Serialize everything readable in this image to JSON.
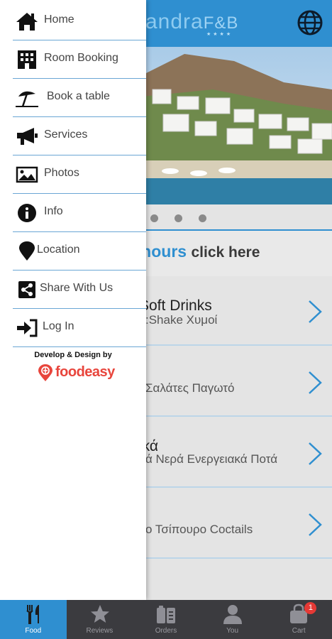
{
  "header": {
    "logo_text": "andra",
    "logo_suffix": "F&B",
    "logo_stars": "★★★★",
    "language_icon": "globe-icon"
  },
  "banner": {
    "slides_count": 3,
    "active_slide": 1
  },
  "hours_banner": {
    "highlight": "e hours",
    "link_text": "click here"
  },
  "categories": [
    {
      "title": "Soft Drinks",
      "subtitle": ":Shake Χυμοί"
    },
    {
      "title": "",
      "subtitle": "Σαλάτες Παγωτό"
    },
    {
      "title": "ικά",
      "subtitle": "ά Νερά Ενεργειακά Ποτά"
    },
    {
      "title": "",
      "subtitle": "ο Τσίπουρο Coctails"
    }
  ],
  "drawer": {
    "items": [
      {
        "label": "Home",
        "icon": "home-icon"
      },
      {
        "label": "Room Booking",
        "icon": "hotel-icon"
      },
      {
        "label": "Book a table",
        "icon": "beach-umbrella-icon"
      },
      {
        "label": "Services",
        "icon": "megaphone-icon"
      },
      {
        "label": "Photos",
        "icon": "image-icon"
      },
      {
        "label": "Info",
        "icon": "info-icon"
      },
      {
        "label": "Location",
        "icon": "map-pin-icon"
      },
      {
        "label": "Share With Us",
        "icon": "share-icon"
      },
      {
        "label": "Log In",
        "icon": "login-icon"
      }
    ],
    "credit_text": "Develop & Design by",
    "brand_name": "foodeasy"
  },
  "tabbar": {
    "tabs": [
      {
        "label": "Food",
        "icon": "utensils-icon",
        "active": true
      },
      {
        "label": "Reviews",
        "icon": "star-icon",
        "active": false
      },
      {
        "label": "Orders",
        "icon": "orders-icon",
        "active": false
      },
      {
        "label": "You",
        "icon": "user-icon",
        "active": false
      },
      {
        "label": "Cart",
        "icon": "cart-bag-icon",
        "active": false,
        "badge": "1"
      }
    ]
  },
  "colors": {
    "accent": "#2f8fd0",
    "tabbar": "#3b3b3f",
    "brand": "#e8453c",
    "badge": "#e53935"
  }
}
